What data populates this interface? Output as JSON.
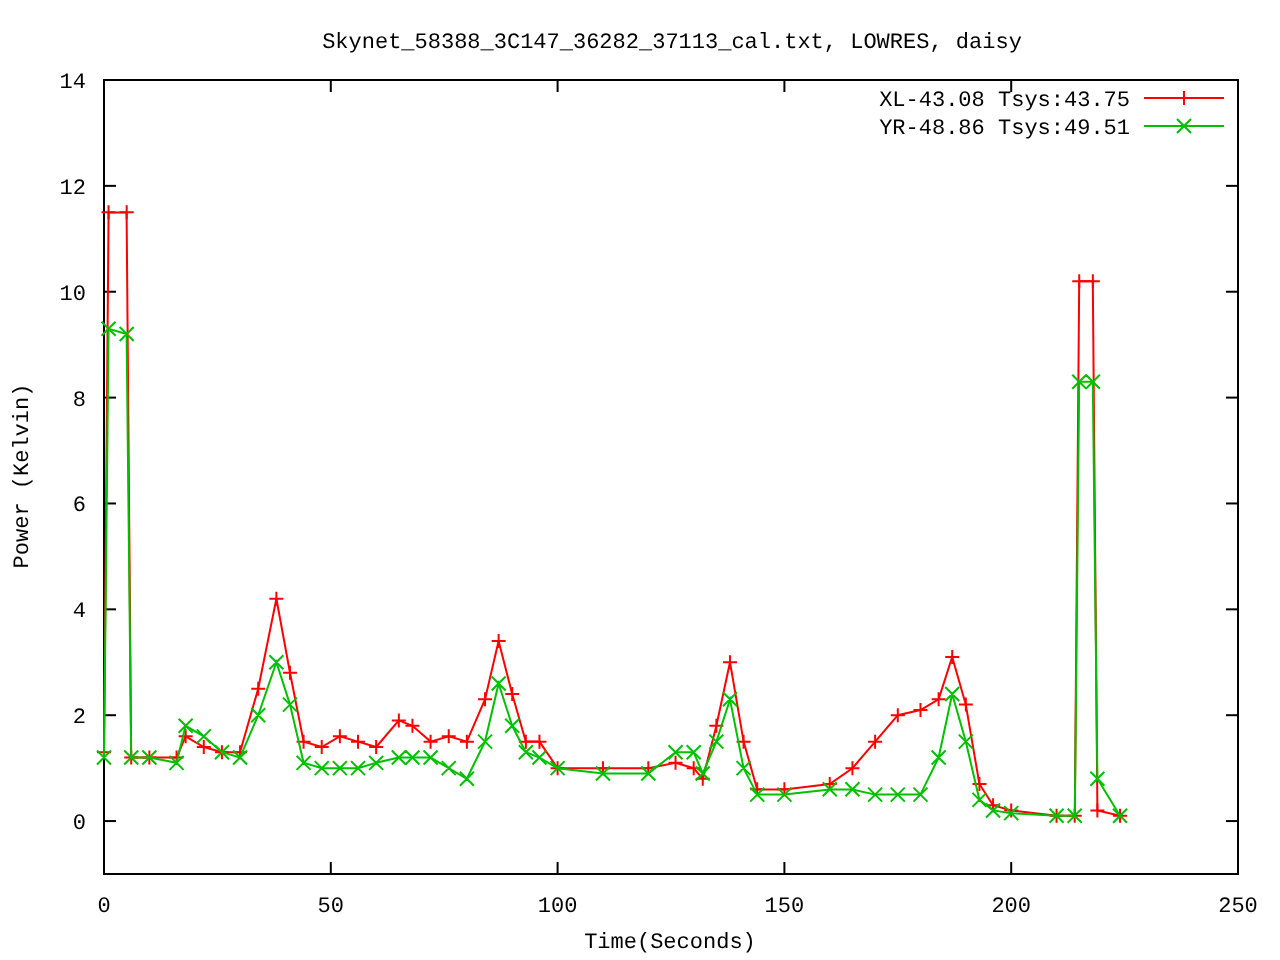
{
  "chart_data": {
    "type": "line",
    "title": "Skynet_58388_3C147_36282_37113_cal.txt, LOWRES, daisy",
    "xlabel": "Time(Seconds)",
    "ylabel": "Power (Kelvin)",
    "legend": true,
    "xlim": [
      0,
      250
    ],
    "ylim": [
      -1,
      14
    ],
    "xticks": [
      0,
      50,
      100,
      150,
      200,
      250
    ],
    "yticks": [
      0,
      2,
      4,
      6,
      8,
      10,
      12,
      14
    ],
    "x": [
      0,
      1,
      5,
      6,
      10,
      16,
      18,
      22,
      26,
      30,
      34,
      38,
      41,
      44,
      48,
      52,
      56,
      60,
      65,
      68,
      72,
      76,
      80,
      84,
      87,
      90,
      93,
      96,
      100,
      110,
      120,
      126,
      130,
      132,
      135,
      138,
      141,
      144,
      150,
      160,
      165,
      170,
      175,
      180,
      184,
      187,
      190,
      193,
      196,
      200,
      210,
      214,
      215,
      218,
      219,
      224
    ],
    "series": [
      {
        "name": "XL-43.08 Tsys:43.75",
        "color": "#ff0000",
        "marker": "plus",
        "values": [
          1.3,
          11.5,
          11.5,
          1.2,
          1.2,
          1.2,
          1.6,
          1.4,
          1.3,
          1.3,
          2.5,
          4.2,
          2.8,
          1.5,
          1.4,
          1.6,
          1.5,
          1.4,
          1.9,
          1.8,
          1.5,
          1.6,
          1.5,
          2.3,
          3.4,
          2.4,
          1.5,
          1.5,
          1.0,
          1.0,
          1.0,
          1.1,
          1.0,
          0.8,
          1.8,
          3.0,
          1.5,
          0.6,
          0.6,
          0.7,
          1.0,
          1.5,
          2.0,
          2.1,
          2.3,
          3.1,
          2.2,
          0.7,
          0.3,
          0.2,
          0.1,
          0.1,
          10.2,
          10.2,
          0.2,
          0.1
        ]
      },
      {
        "name": "YR-48.86 Tsys:49.51",
        "color": "#00c000",
        "marker": "x",
        "values": [
          1.2,
          9.3,
          9.2,
          1.2,
          1.2,
          1.1,
          1.8,
          1.6,
          1.3,
          1.2,
          2.0,
          3.0,
          2.2,
          1.1,
          1.0,
          1.0,
          1.0,
          1.1,
          1.2,
          1.2,
          1.2,
          1.0,
          0.8,
          1.5,
          2.6,
          1.8,
          1.3,
          1.2,
          1.0,
          0.9,
          0.9,
          1.3,
          1.3,
          0.9,
          1.5,
          2.3,
          1.0,
          0.5,
          0.5,
          0.6,
          0.6,
          0.5,
          0.5,
          0.5,
          1.2,
          2.4,
          1.5,
          0.4,
          0.2,
          0.15,
          0.1,
          0.1,
          8.3,
          8.3,
          0.8,
          0.1
        ]
      }
    ]
  }
}
